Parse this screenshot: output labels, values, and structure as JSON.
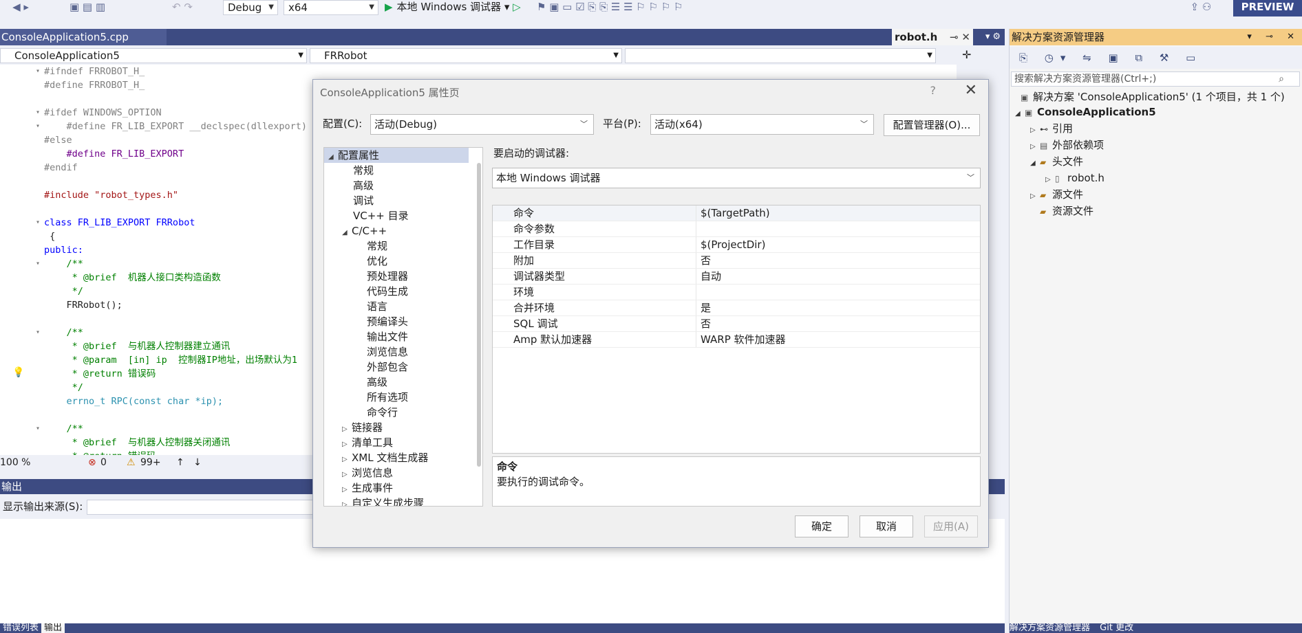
{
  "toolbar": {
    "config": "Debug",
    "platform": "x64",
    "run_label": "本地 Windows 调试器",
    "preview": "PREVIEW"
  },
  "editor": {
    "tab_title": "ConsoleApplication5.cpp",
    "tab_robot": "robot.h",
    "nav_project": "ConsoleApplication5",
    "nav_class": "FRRobot",
    "nav_member": "",
    "zoom": "100 %",
    "errors": "0",
    "warnings": "99+",
    "lines": [
      "#ifndef FRROBOT_H_",
      "#define FRROBOT_H_",
      "",
      "#ifdef WINDOWS_OPTION",
      "    #define FR_LIB_EXPORT __declspec(dllexport)",
      "#else",
      "    #define FR_LIB_EXPORT",
      "#endif",
      "",
      "#include \"robot_types.h\"",
      "",
      "class FR_LIB_EXPORT FRRobot",
      " {",
      "public:",
      "    /**",
      "     * @brief  机器人接口类构造函数",
      "     */",
      "    FRRobot();",
      "",
      "    /**",
      "     * @brief  与机器人控制器建立通讯",
      "     * @param  [in] ip  控制器IP地址，出场默认为1",
      "     * @return 错误码",
      "     */",
      "    errno_t RPC(const char *ip);",
      "",
      "    /**",
      "     * @brief  与机器人控制器关闭通讯",
      "     * @return 错误码"
    ]
  },
  "output": {
    "title": "输出",
    "source_label": "显示输出来源(S):",
    "tabs": [
      "错误列表",
      "输出"
    ]
  },
  "solution": {
    "title": "解决方案资源管理器",
    "search_placeholder": "搜索解决方案资源管理器(Ctrl+;)",
    "root": "解决方案 'ConsoleApplication5' (1 个项目，共 1 个)",
    "project": "ConsoleApplication5",
    "items": [
      "引用",
      "外部依赖项",
      "头文件",
      "robot.h",
      "源文件",
      "资源文件"
    ],
    "bottom_tabs": [
      "解决方案资源管理器",
      "Git 更改"
    ]
  },
  "dialog": {
    "title": "ConsoleApplication5 属性页",
    "config_label": "配置(C):",
    "config_value": "活动(Debug)",
    "platform_label": "平台(P):",
    "platform_value": "活动(x64)",
    "config_manager": "配置管理器(O)...",
    "tree": {
      "root": "配置属性",
      "items": [
        "常规",
        "高级",
        "调试",
        "VC++ 目录"
      ],
      "cpp": "C/C++",
      "cpp_items": [
        "常规",
        "优化",
        "预处理器",
        "代码生成",
        "语言",
        "预编译头",
        "输出文件",
        "浏览信息",
        "外部包含",
        "高级",
        "所有选项",
        "命令行"
      ],
      "groups": [
        "链接器",
        "清单工具",
        "XML 文档生成器",
        "浏览信息",
        "生成事件",
        "自定义生成步骤"
      ]
    },
    "debugger_label": "要启动的调试器:",
    "debugger_value": "本地 Windows 调试器",
    "props": [
      {
        "name": "命令",
        "value": "$(TargetPath)"
      },
      {
        "name": "命令参数",
        "value": ""
      },
      {
        "name": "工作目录",
        "value": "$(ProjectDir)"
      },
      {
        "name": "附加",
        "value": "否"
      },
      {
        "name": "调试器类型",
        "value": "自动"
      },
      {
        "name": "环境",
        "value": ""
      },
      {
        "name": "合并环境",
        "value": "是"
      },
      {
        "name": "SQL 调试",
        "value": "否"
      },
      {
        "name": "Amp 默认加速器",
        "value": "WARP 软件加速器"
      }
    ],
    "desc_title": "命令",
    "desc_text": "要执行的调试命令。",
    "ok": "确定",
    "cancel": "取消",
    "apply": "应用(A)"
  }
}
